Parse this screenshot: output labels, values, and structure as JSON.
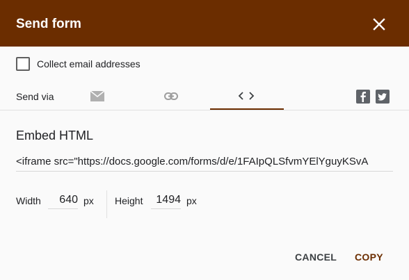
{
  "header": {
    "title": "Send form",
    "close_icon": "close-icon"
  },
  "collect_email": {
    "label": "Collect email addresses",
    "checked": false
  },
  "send_via": {
    "label": "Send via",
    "tabs": [
      {
        "name": "email",
        "icon": "email-icon"
      },
      {
        "name": "link",
        "icon": "link-icon"
      },
      {
        "name": "embed",
        "icon": "code-icon",
        "selected": true
      }
    ],
    "social": [
      {
        "icon": "facebook-icon"
      },
      {
        "icon": "twitter-icon"
      }
    ]
  },
  "embed": {
    "title": "Embed HTML",
    "code": "<iframe src=\"https://docs.google.com/forms/d/e/1FAIpQLSfvmYElYguyKSvA",
    "width_label": "Width",
    "width_value": "640",
    "width_unit": "px",
    "height_label": "Height",
    "height_value": "1494",
    "height_unit": "px"
  },
  "actions": {
    "cancel_label": "CANCEL",
    "copy_label": "COPY"
  },
  "colors": {
    "header_bg": "#6b2d00",
    "accent": "#6b2d00",
    "icon_gray": "#9aa0a6"
  }
}
